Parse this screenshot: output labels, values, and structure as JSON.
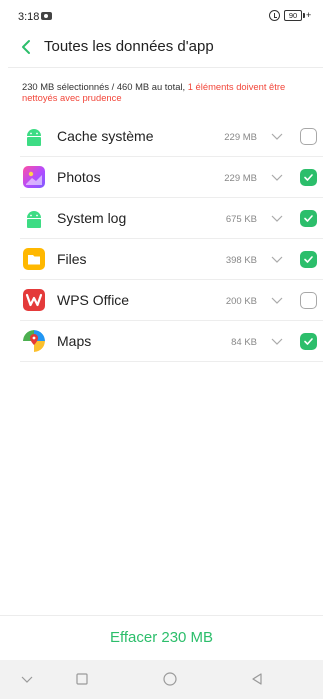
{
  "status_bar": {
    "time": "3:18",
    "battery": "90",
    "charging_symbol": "+"
  },
  "header": {
    "title": "Toutes les données d'app"
  },
  "summary": {
    "text": "230 MB sélectionnés / 460 MB au total, ",
    "warning": "1 éléments doivent être nettoyés avec prudence",
    "warning_color": "#f2463a"
  },
  "apps": [
    {
      "name": "Cache système",
      "size": "229 MB",
      "checked": false,
      "icon": "android-icon"
    },
    {
      "name": "Photos",
      "size": "229 MB",
      "checked": true,
      "icon": "photos-icon"
    },
    {
      "name": "System log",
      "size": "675 KB",
      "checked": true,
      "icon": "android-icon"
    },
    {
      "name": "Files",
      "size": "398 KB",
      "checked": true,
      "icon": "files-icon"
    },
    {
      "name": "WPS Office",
      "size": "200 KB",
      "checked": false,
      "icon": "wps-icon"
    },
    {
      "name": "Maps",
      "size": "84 KB",
      "checked": true,
      "icon": "maps-icon"
    }
  ],
  "footer": {
    "clear_label": "Effacer 230 MB"
  },
  "colors": {
    "accent": "#2cbe6b",
    "warning": "#f2463a"
  }
}
